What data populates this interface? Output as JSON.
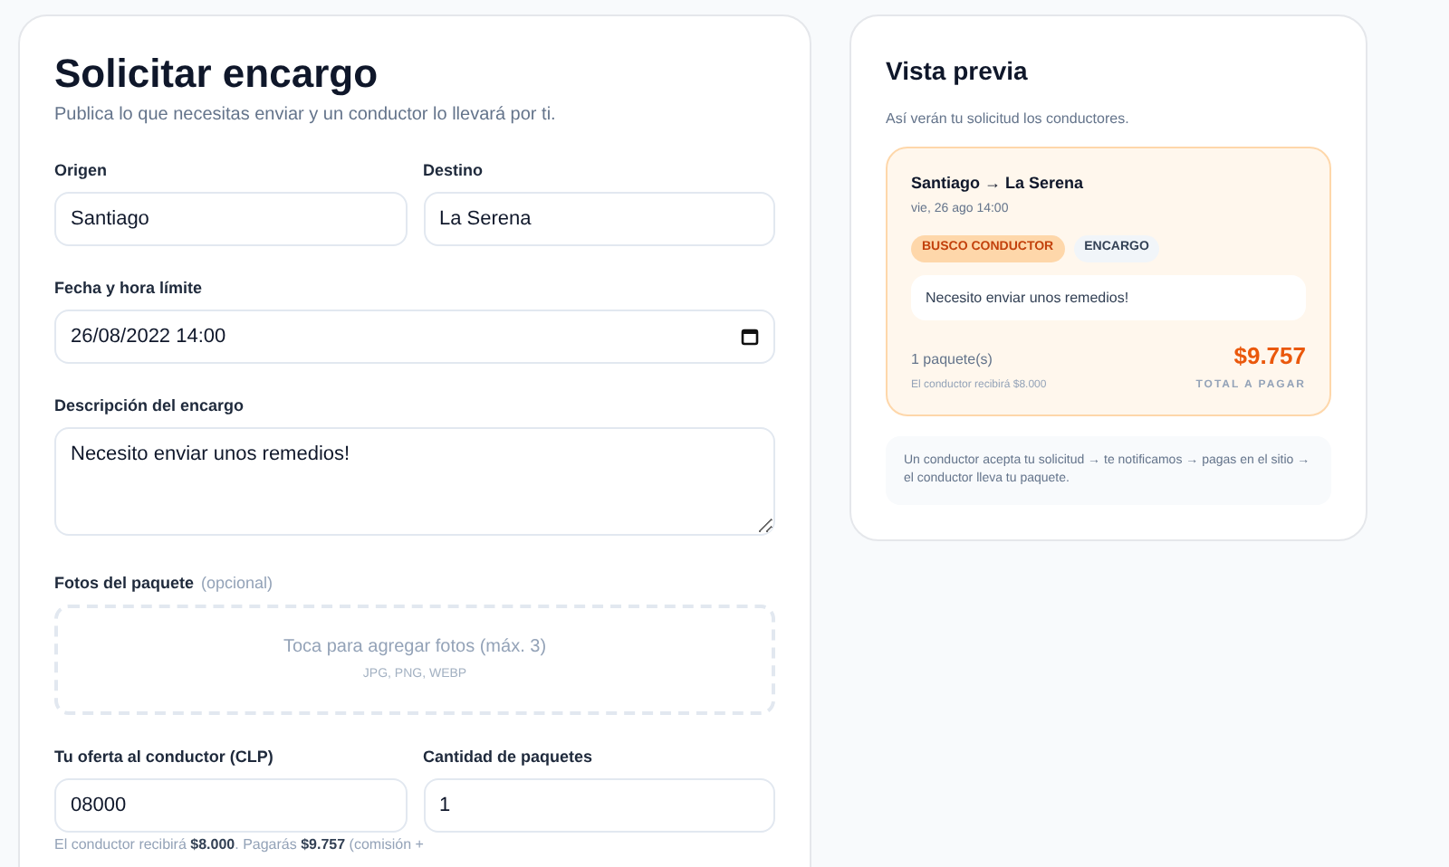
{
  "form": {
    "title": "Solicitar encargo",
    "subtitle": "Publica lo que necesitas enviar y un conductor lo llevará por ti.",
    "origin": {
      "label": "Origen",
      "value": "Santiago"
    },
    "destination": {
      "label": "Destino",
      "value": "La Serena"
    },
    "deadline": {
      "label": "Fecha y hora límite",
      "value": "26/08/2022 14:00"
    },
    "description": {
      "label": "Descripción del encargo",
      "value": "Necesito enviar unos remedios!"
    },
    "photos": {
      "label": "Fotos del paquete",
      "optional": "(opcional)",
      "prompt": "Toca para agregar fotos (máx. 3)",
      "formats": "JPG, PNG, WEBP"
    },
    "offer": {
      "label": "Tu oferta al conductor (CLP)",
      "value": "08000",
      "help": "El conductor recibirá **$8.000**. Pagarás **$9.757** (comisión +"
    },
    "quantity": {
      "label": "Cantidad de paquetes",
      "value": "1"
    }
  },
  "preview": {
    "title": "Vista previa",
    "subtitle": "Así verán tu solicitud los conductores.",
    "card": {
      "route": "Santiago → La Serena",
      "date": "vie, 26 ago 14:00",
      "badges": [
        {
          "label": "BUSCO CONDUCTOR",
          "kind": "status"
        },
        {
          "label": "ENCARGO",
          "kind": "type"
        }
      ],
      "note": "Necesito enviar unos remedios!",
      "packages": "1 paquete(s)",
      "driver_gets": "El conductor recibirá $8.000",
      "price": "$9.757",
      "price_label": "TOTAL A PAGAR"
    },
    "steps": "Un conductor acepta tu solicitud → te notificamos → pagas en el sitio → el conductor lleva tu paquete."
  }
}
